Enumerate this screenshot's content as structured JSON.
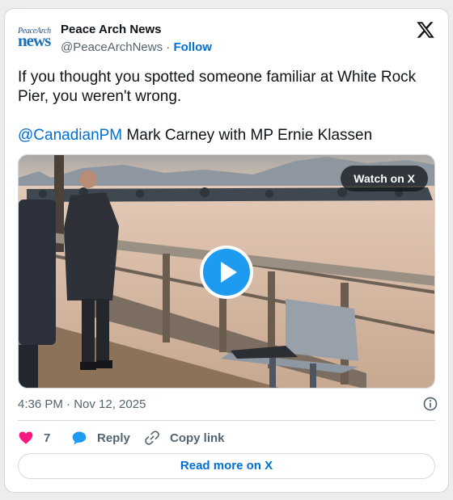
{
  "author": {
    "logo_line1": "PeaceArch",
    "logo_line2": "news",
    "name": "Peace Arch News",
    "handle": "@PeaceArchNews",
    "separator": "·",
    "follow_label": "Follow"
  },
  "tweet": {
    "line1": "If you thought you spotted someone familiar at White Rock Pier, you weren't wrong.",
    "mention": "@CanadianPM",
    "line2_rest": " Mark Carney with MP Ernie Klassen"
  },
  "media": {
    "watch_label": "Watch on X",
    "icon": "play-icon"
  },
  "footer": {
    "time": "4:36 PM · Nov 12, 2025",
    "info_icon": "info-icon",
    "like_count": "7",
    "reply_label": "Reply",
    "copy_label": "Copy link",
    "read_more_label": "Read more on X"
  },
  "colors": {
    "accent": "#006fd6",
    "play": "#1d9bf0",
    "like": "#f91880",
    "reply": "#1d9bf0"
  }
}
